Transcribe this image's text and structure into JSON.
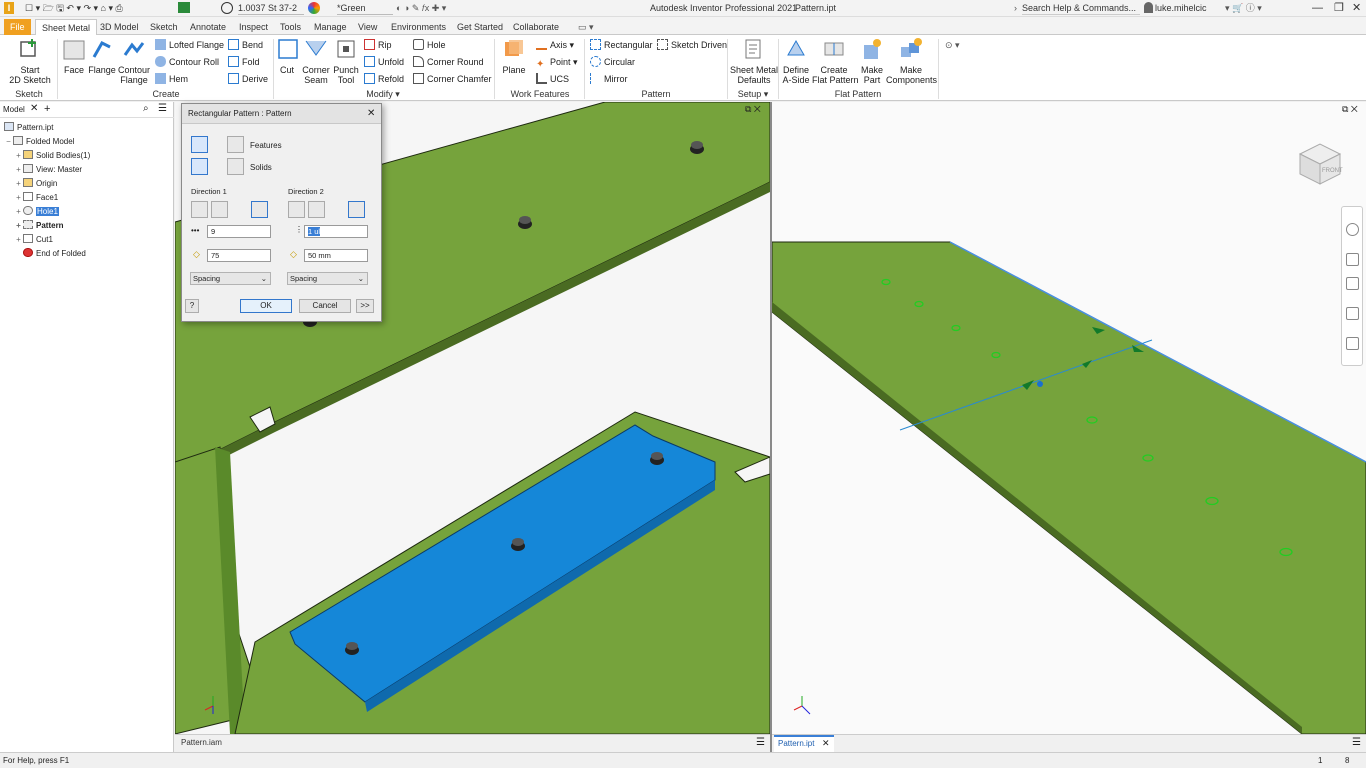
{
  "app": {
    "title": "Autodesk Inventor Professional 2021",
    "file": "Pattern.ipt",
    "material": "1.0037 St 37-2",
    "appearance": "*Green",
    "search_placeholder": "Search Help & Commands...",
    "user": "luke.mihelcic"
  },
  "tabs": [
    "File",
    "Sheet Metal",
    "3D Model",
    "Sketch",
    "Annotate",
    "Inspect",
    "Tools",
    "Manage",
    "View",
    "Environments",
    "Get Started",
    "Collaborate"
  ],
  "ribbon": {
    "start_sketch": "Start\n2D Sketch",
    "face": "Face",
    "flange": "Flange",
    "contour_flange": "Contour\nFlange",
    "lofted_flange": "Lofted Flange",
    "contour_roll": "Contour Roll",
    "hem": "Hem",
    "bend": "Bend",
    "fold": "Fold",
    "derive": "Derive",
    "cut": "Cut",
    "corner_seam": "Corner\nSeam",
    "punch_tool": "Punch\nTool",
    "rip": "Rip",
    "unfold": "Unfold",
    "refold": "Refold",
    "hole": "Hole",
    "corner_round": "Corner Round",
    "corner_chamfer": "Corner Chamfer",
    "plane": "Plane",
    "axis": "Axis",
    "point": "Point",
    "ucs": "UCS",
    "rectangular": "Rectangular",
    "circular": "Circular",
    "mirror": "Mirror",
    "sketch_driven": "Sketch Driven",
    "sheet_metal_defaults": "Sheet Metal\nDefaults",
    "define_a_side": "Define\nA-Side",
    "create_flat_pattern": "Create\nFlat Pattern",
    "make_part": "Make\nPart",
    "make_components": "Make\nComponents",
    "groups": {
      "sketch": "Sketch",
      "create": "Create",
      "modify": "Modify",
      "work_features": "Work Features",
      "pattern": "Pattern",
      "setup": "Setup",
      "flat_pattern": "Flat Pattern"
    }
  },
  "browser": {
    "tab": "Model",
    "root": "Pattern.ipt",
    "items": [
      {
        "label": "Folded Model",
        "bold": false
      },
      {
        "label": "Solid Bodies(1)",
        "bold": false
      },
      {
        "label": "View: Master",
        "bold": false
      },
      {
        "label": "Origin",
        "bold": false
      },
      {
        "label": "Face1",
        "bold": false
      },
      {
        "label": "Hole1",
        "bold": false
      },
      {
        "label": "Pattern",
        "bold": true
      },
      {
        "label": "Cut1",
        "bold": false
      },
      {
        "label": "End of Folded",
        "bold": false
      }
    ]
  },
  "dialog": {
    "title": "Rectangular Pattern : Pattern",
    "features": "Features",
    "solids": "Solids",
    "direction1": "Direction 1",
    "direction2": "Direction 2",
    "d1_count": "9",
    "d1_spacing": "75",
    "d1_type": "Spacing",
    "d2_count": "1 ul",
    "d2_spacing": "50 mm",
    "d2_type": "Spacing",
    "ok": "OK",
    "cancel": "Cancel",
    "more": ">>",
    "help": "?"
  },
  "doc_tabs": {
    "left": "Pattern.iam",
    "right": "Pattern.ipt"
  },
  "status": {
    "help": "For Help, press F1",
    "n1": "1",
    "n2": "8"
  },
  "viewcube": {
    "label": "FRONT"
  },
  "colors": {
    "plate_green": "#76a33c",
    "plate_edge": "#1e2a10",
    "highlight_blue": "#1587d8",
    "file_tab": "#f0a020"
  }
}
